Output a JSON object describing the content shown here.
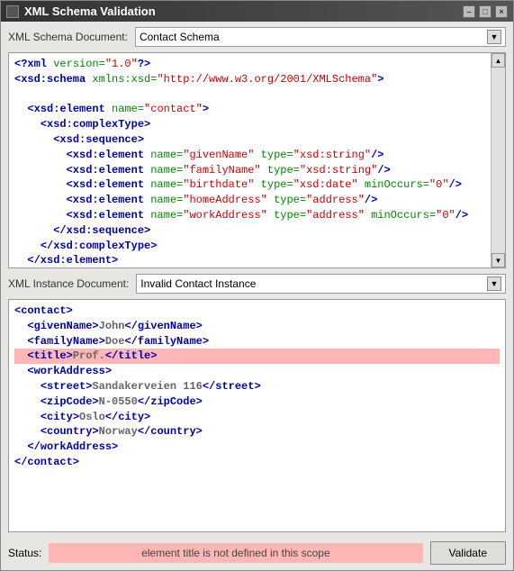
{
  "window": {
    "title": "XML Schema Validation"
  },
  "schema_row": {
    "label": "XML Schema Document:",
    "selected": "Contact Schema"
  },
  "instance_row": {
    "label": "XML Instance Document:",
    "selected": "Invalid Contact Instance"
  },
  "status": {
    "label": "Status:",
    "message": "element title is not defined in this scope"
  },
  "validate_btn": "Validate",
  "schema_code": {
    "line1_open": "<?xml",
    "line1_attr_name": " version=",
    "line1_attr_val": "\"1.0\"",
    "line1_close": "?>",
    "line2_open": "<xsd:schema",
    "line2_attr_name": " xmlns:xsd=",
    "line2_attr_val": "\"http://www.w3.org/2001/XMLSchema\"",
    "line2_close": ">",
    "el_open": "<xsd:element",
    "el_close": ">",
    "el_close_self": "/>",
    "ct_open": "<xsd:complexType>",
    "ct_close": "</xsd:complexType>",
    "seq_open": "<xsd:sequence>",
    "seq_close": "</xsd:sequence>",
    "el_end": "</xsd:element>",
    "name_attr": " name=",
    "type_attr": " type=",
    "min_attr": " minOccurs=",
    "contact": "\"contact\"",
    "givenName": "\"givenName\"",
    "familyName": "\"familyName\"",
    "birthdate": "\"birthdate\"",
    "homeAddress": "\"homeAddress\"",
    "workAddress": "\"workAddress\"",
    "xsd_string": "\"xsd:string\"",
    "xsd_date": "\"xsd:date\"",
    "address": "\"address\"",
    "zero": "\"0\""
  },
  "instance_code": {
    "contact_open": "<contact>",
    "contact_close": "</contact>",
    "gn_open": "<givenName>",
    "gn_val": "John",
    "gn_close": "</givenName>",
    "fn_open": "<familyName>",
    "fn_val": "Doe",
    "fn_close": "</familyName>",
    "title_open": "<title>",
    "title_val": "Prof.",
    "title_close": "</title>",
    "wa_open": "<workAddress>",
    "wa_close": "</workAddress>",
    "street_open": "<street>",
    "street_val": "Sandakerveien 116",
    "street_close": "</street>",
    "zip_open": "<zipCode>",
    "zip_val": "N-0550",
    "zip_close": "</zipCode>",
    "city_open": "<city>",
    "city_val": "Oslo",
    "city_close": "</city>",
    "country_open": "<country>",
    "country_val": "Norway",
    "country_close": "</country>"
  }
}
